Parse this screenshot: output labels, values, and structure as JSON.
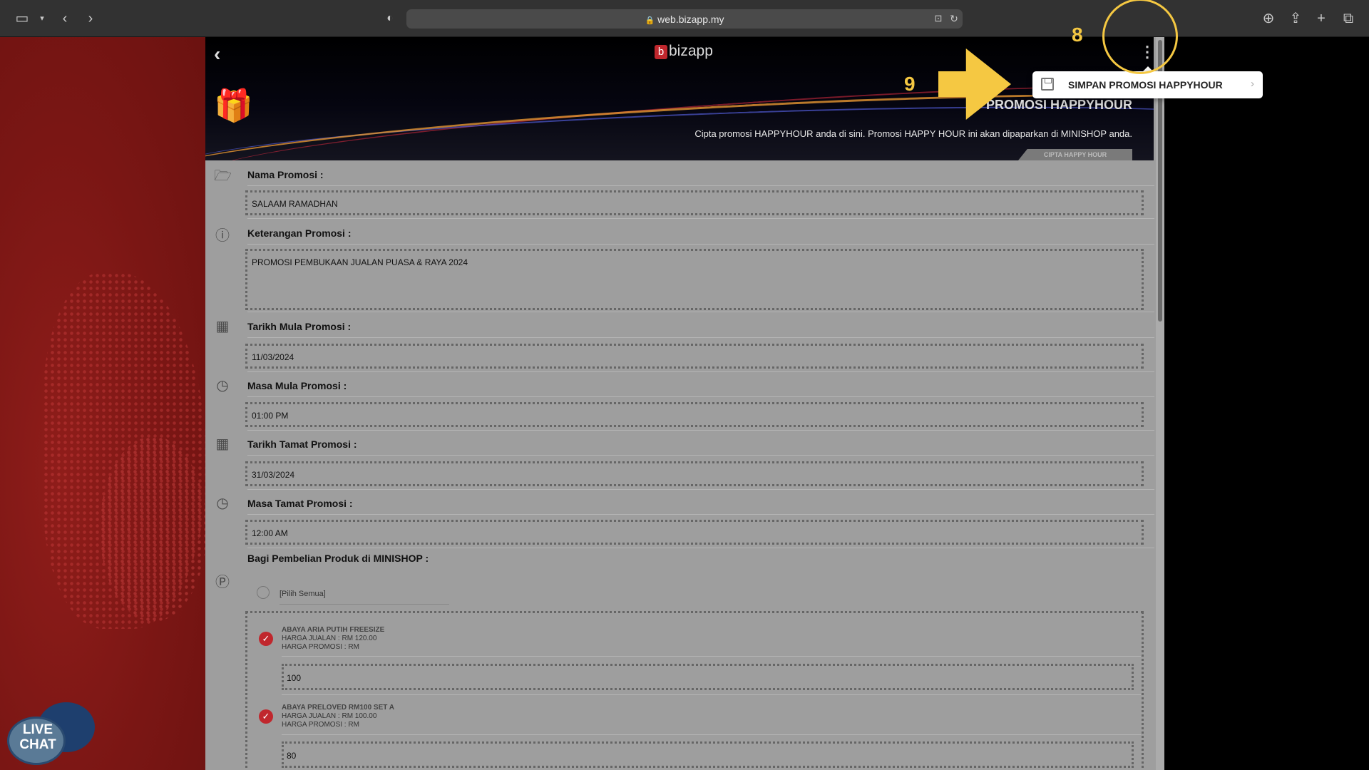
{
  "browser": {
    "url": "web.bizapp.my"
  },
  "header": {
    "logo": "bizapp",
    "title": "PROMOSI HAPPYHOUR",
    "subtitle": "Cipta promosi HAPPYHOUR anda di sini. Promosi HAPPY HOUR ini akan dipaparkan di MINISHOP anda.",
    "tab": "CIPTA HAPPY HOUR"
  },
  "menu": {
    "save_label": "SIMPAN PROMOSI HAPPYHOUR"
  },
  "annotations": {
    "step8": "8",
    "step9": "9"
  },
  "form": {
    "nama": {
      "label": "Nama Promosi :",
      "value": "SALAAM RAMADHAN"
    },
    "keterangan": {
      "label": "Keterangan Promosi :",
      "value": "PROMOSI PEMBUKAAN JUALAN PUASA & RAYA 2024"
    },
    "tarikh_mula": {
      "label": "Tarikh Mula Promosi :",
      "value": "11/03/2024"
    },
    "masa_mula": {
      "label": "Masa Mula Promosi :",
      "value": "01:00 PM"
    },
    "tarikh_tamat": {
      "label": "Tarikh Tamat Promosi :",
      "value": "31/03/2024"
    },
    "masa_tamat": {
      "label": "Masa Tamat Promosi :",
      "value": "12:00 AM"
    },
    "produk_label": "Bagi Pembelian Produk di MINISHOP :",
    "pilih_semua": "[Pilih Semua]"
  },
  "products": [
    {
      "name": "ABAYA ARIA PUTIH FREESIZE",
      "harga_jualan": "HARGA JUALAN : RM 120.00",
      "harga_promosi": "HARGA PROMOSI : RM",
      "value": "100"
    },
    {
      "name": "ABAYA PRELOVED RM100 SET A",
      "harga_jualan": "HARGA JUALAN : RM 100.00",
      "harga_promosi": "HARGA PROMOSI : RM",
      "value": "80"
    }
  ],
  "livechat": {
    "line1": "LIVE",
    "line2": "CHAT"
  },
  "colors": {
    "accent": "#c0272d",
    "annotation": "#f5c842",
    "left_panel": "#7a1614"
  }
}
